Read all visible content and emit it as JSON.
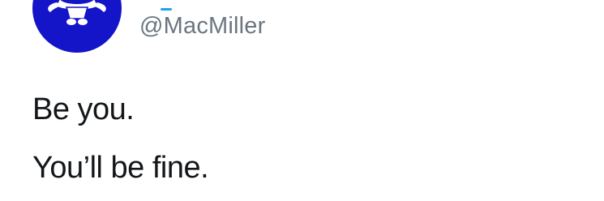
{
  "tweet": {
    "author": {
      "handle": "@MacMiller",
      "avatar_icon": "cartoon-character-avatar-icon",
      "avatar_color": "#1414c8"
    },
    "text_lines": [
      "Be you.",
      "You’ll be fine."
    ]
  }
}
